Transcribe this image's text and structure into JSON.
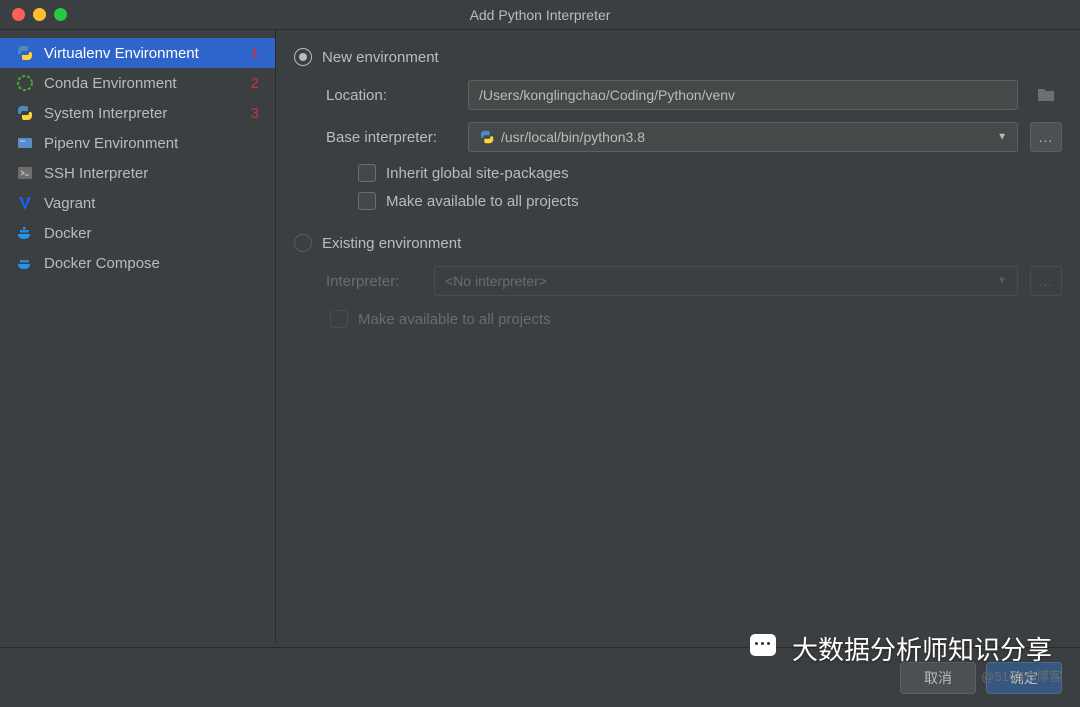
{
  "title": "Add Python Interpreter",
  "sidebar": {
    "items": [
      {
        "label": "Virtualenv Environment",
        "badge": "1"
      },
      {
        "label": "Conda Environment",
        "badge": "2"
      },
      {
        "label": "System Interpreter",
        "badge": "3"
      },
      {
        "label": "Pipenv Environment",
        "badge": ""
      },
      {
        "label": "SSH Interpreter",
        "badge": ""
      },
      {
        "label": "Vagrant",
        "badge": ""
      },
      {
        "label": "Docker",
        "badge": ""
      },
      {
        "label": "Docker Compose",
        "badge": ""
      }
    ]
  },
  "new_env": {
    "radio_label": "New environment",
    "location_label": "Location:",
    "location_value": "/Users/konglingchao/Coding/Python/venv",
    "base_label": "Base interpreter:",
    "base_value": "/usr/local/bin/python3.8",
    "inherit_label": "Inherit global site-packages",
    "available_label": "Make available to all projects"
  },
  "existing_env": {
    "radio_label": "Existing environment",
    "interpreter_label": "Interpreter:",
    "interpreter_value": "<No interpreter>",
    "available_label": "Make available to all projects"
  },
  "footer": {
    "cancel": "取消",
    "ok": "确定"
  },
  "watermark": {
    "text": "大数据分析师知识分享",
    "sub": "@51CTO博客"
  }
}
